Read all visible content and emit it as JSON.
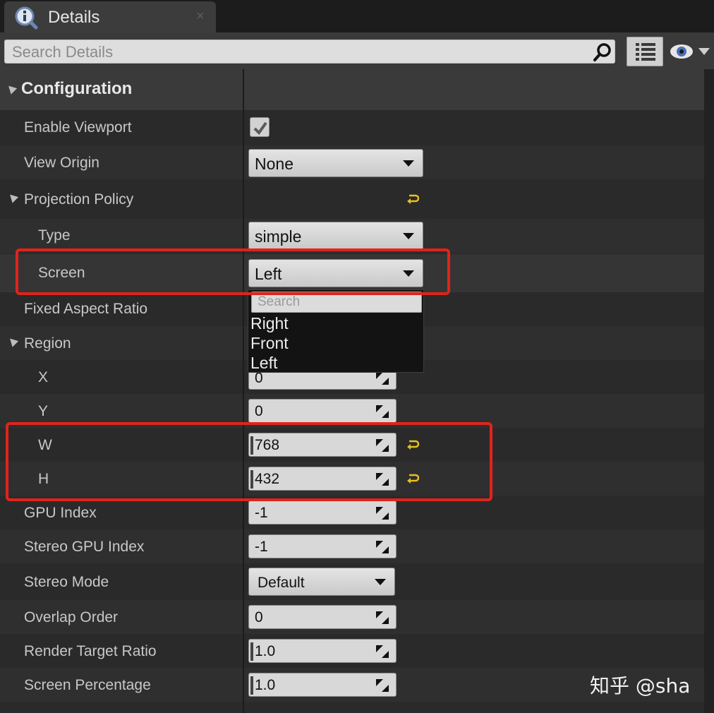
{
  "tab": {
    "title": "Details",
    "close_glyph": "×",
    "icon": "details-info-icon"
  },
  "search": {
    "placeholder": "Search Details",
    "value": ""
  },
  "toolbar": {
    "view_options_icon": "list-view-icon",
    "visibility_icon": "eye-icon"
  },
  "category": {
    "title": "Configuration"
  },
  "properties": {
    "enable_viewport": {
      "label": "Enable Viewport",
      "checked": true
    },
    "view_origin": {
      "label": "View Origin",
      "value": "None"
    },
    "projection_policy": {
      "label": "Projection Policy"
    },
    "type": {
      "label": "Type",
      "value": "simple"
    },
    "screen": {
      "label": "Screen",
      "value": "Left"
    },
    "fixed_aspect_ratio": {
      "label": "Fixed Aspect Ratio"
    },
    "region": {
      "label": "Region"
    },
    "x": {
      "label": "X",
      "value": "0"
    },
    "y": {
      "label": "Y",
      "value": "0"
    },
    "w": {
      "label": "W",
      "value": "768"
    },
    "h": {
      "label": "H",
      "value": "432"
    },
    "gpu_index": {
      "label": "GPU Index",
      "value": "-1"
    },
    "stereo_gpu_index": {
      "label": "Stereo GPU Index",
      "value": "-1"
    },
    "stereo_mode": {
      "label": "Stereo Mode",
      "value": "Default"
    },
    "overlap_order": {
      "label": "Overlap Order",
      "value": "0"
    },
    "render_target_ratio": {
      "label": "Render Target Ratio",
      "value": "1.0"
    },
    "screen_percentage": {
      "label": "Screen Percentage",
      "value": "1.0"
    }
  },
  "screen_dropdown": {
    "search_placeholder": "Search",
    "options": [
      "Right",
      "Front",
      "Left"
    ]
  },
  "colors": {
    "annotation": "#e0241c",
    "reset_arrow": "#e8c020"
  },
  "watermark": "知乎 @sha"
}
